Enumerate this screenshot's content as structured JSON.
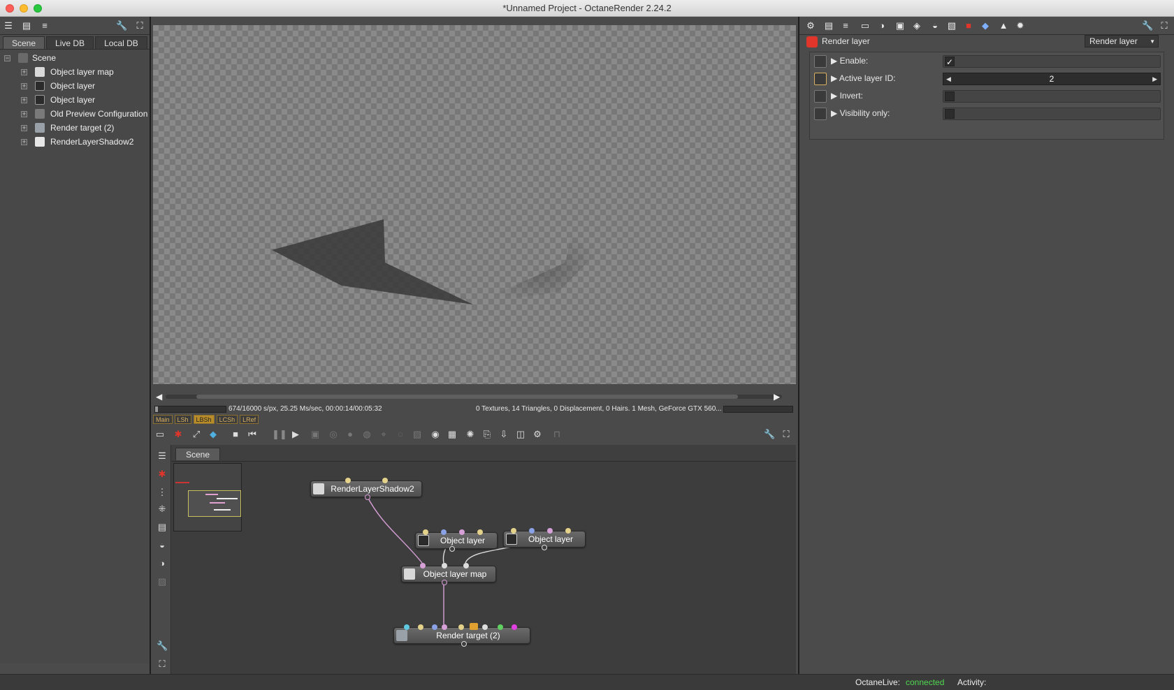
{
  "window": {
    "title": "*Unnamed Project - OctaneRender 2.24.2"
  },
  "left_panel": {
    "tabs": [
      "Scene",
      "Live DB",
      "Local DB"
    ],
    "tree": {
      "root": "Scene",
      "items": [
        {
          "label": "Object layer map",
          "icon": "object-layer-map-icon"
        },
        {
          "label": "Object layer",
          "icon": "object-layer-icon"
        },
        {
          "label": "Object layer",
          "icon": "object-layer-icon"
        },
        {
          "label": "Old Preview Configuration",
          "icon": "preview-config-icon"
        },
        {
          "label": "Render target (2)",
          "icon": "render-target-icon"
        },
        {
          "label": "RenderLayerShadow2",
          "icon": "render-layer-icon"
        }
      ]
    }
  },
  "viewport": {
    "stats_left": "674/16000 s/px, 25.25 Ms/sec, 00:00:14/00:05:32",
    "stats_right": "0 Textures, 14 Triangles, 0 Displacement, 0 Hairs. 1 Mesh, GeForce GTX 560...",
    "progress": 0.042,
    "mode_tabs": [
      "Main",
      "LSh",
      "LBSh",
      "LCSh",
      "LRef"
    ],
    "active_mode": "LBSh"
  },
  "graph_editor": {
    "tab": "Scene",
    "nodes": {
      "render_layer_shadow": "RenderLayerShadow2",
      "object_layer_a": "Object layer",
      "object_layer_b": "Object layer",
      "object_layer_map": "Object layer map",
      "render_target": "Render target (2)"
    }
  },
  "inspector": {
    "node_name": "Render layer",
    "node_type": "Render layer",
    "attributes": {
      "enable": {
        "label": "Enable:",
        "checked": true
      },
      "active_layer_id": {
        "label": "Active layer ID:",
        "value": "2"
      },
      "invert": {
        "label": "Invert:",
        "checked": false
      },
      "visibility_only": {
        "label": "Visibility only:",
        "checked": false
      }
    }
  },
  "statusbar": {
    "live_label": "OctaneLive:",
    "live_status": "connected",
    "activity_label": "Activity:"
  },
  "colors": {
    "accent": "#e0352a",
    "connected": "#4fd84f",
    "mode_active": "#b98c2a"
  }
}
